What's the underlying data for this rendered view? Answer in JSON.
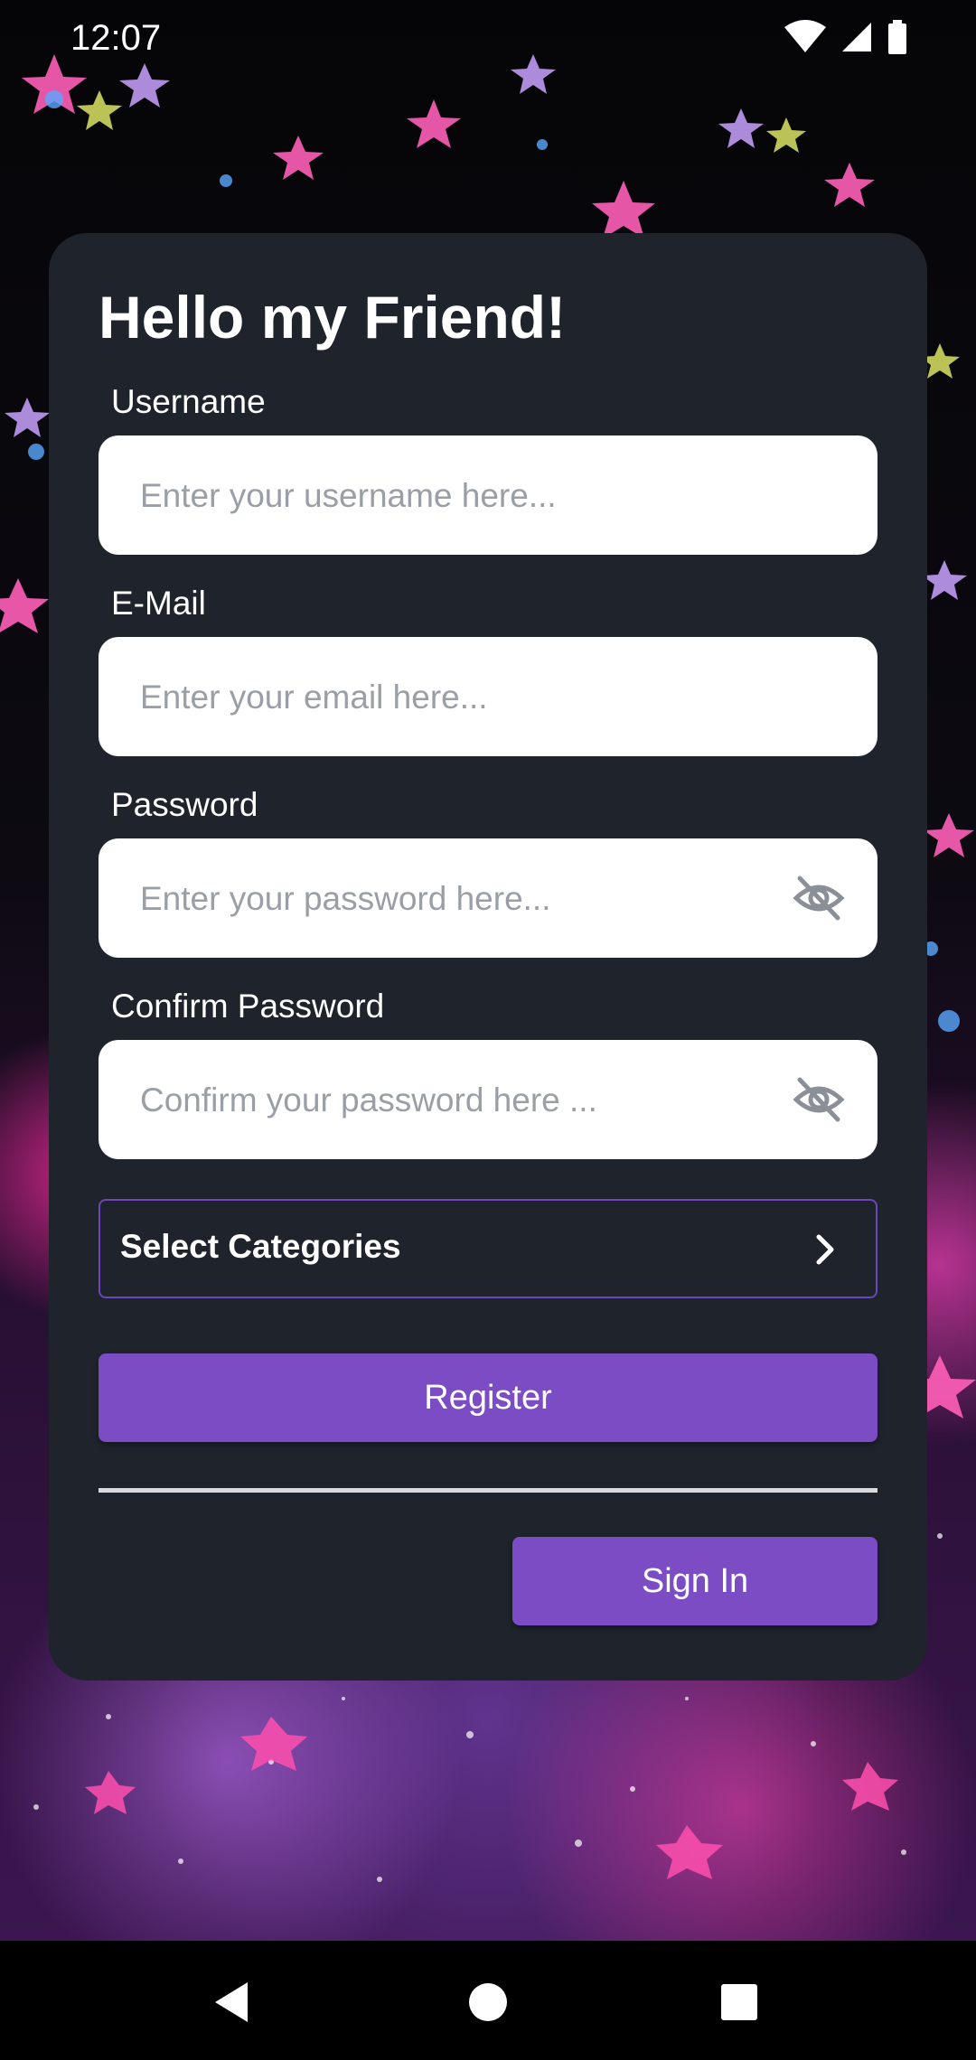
{
  "status_bar": {
    "time": "12:07",
    "icons": [
      "wifi-icon",
      "cellular-signal-icon",
      "battery-icon"
    ]
  },
  "form": {
    "title": "Hello my Friend!",
    "username": {
      "label": "Username",
      "value": "",
      "placeholder": "Enter your username here..."
    },
    "email": {
      "label": "E-Mail",
      "value": "",
      "placeholder": "Enter your email here..."
    },
    "password": {
      "label": "Password",
      "value": "",
      "placeholder": "Enter your password here...",
      "toggle_icon": "eye-off-icon"
    },
    "confirm_password": {
      "label": "Confirm Password",
      "value": "",
      "placeholder": "Confirm your password here ...",
      "toggle_icon": "eye-off-icon"
    },
    "categories": {
      "label": "Select Categories",
      "icon": "chevron-right-icon"
    },
    "register_label": "Register",
    "signin_label": "Sign In"
  },
  "nav_bar": {
    "buttons": [
      "back-icon",
      "home-icon",
      "recents-icon"
    ]
  },
  "colors": {
    "card_bg": "#1e232c",
    "accent": "#7b4cc4",
    "select_border": "#6b47b8",
    "placeholder": "#9a9ea6"
  }
}
